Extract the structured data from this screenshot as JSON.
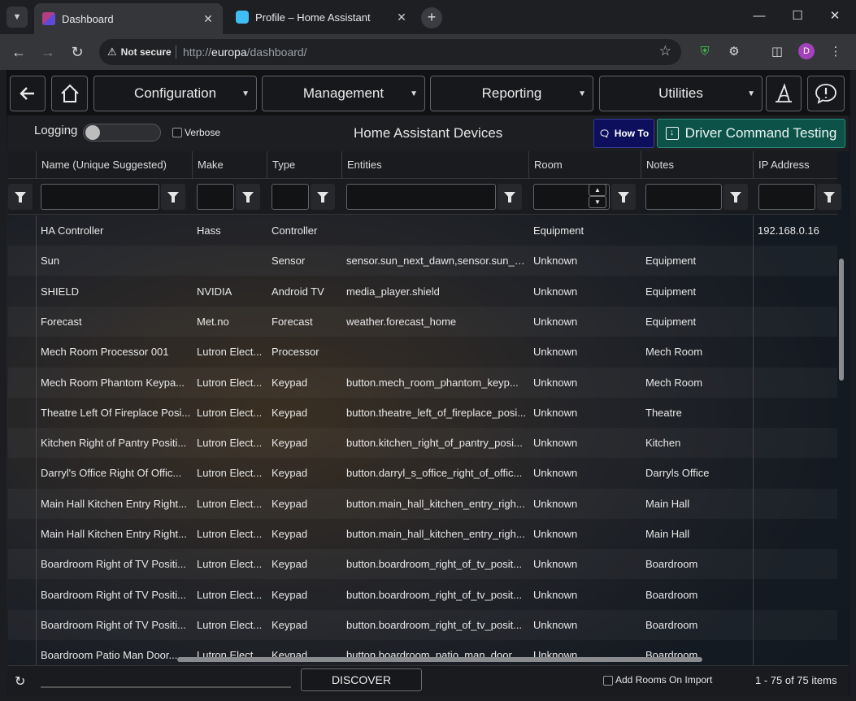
{
  "browser": {
    "tabs": [
      {
        "title": "Dashboard",
        "active": true
      },
      {
        "title": "Profile – Home Assistant",
        "active": false
      }
    ],
    "security_label": "Not secure",
    "url_prefix": "http://",
    "url_host": "europa",
    "url_path": "/dashboard/",
    "avatar_letter": "D"
  },
  "nav": {
    "menus": [
      "Configuration",
      "Management",
      "Reporting",
      "Utilities"
    ]
  },
  "header": {
    "logging_label": "Logging",
    "verbose_label": "Verbose",
    "title": "Home Assistant Devices",
    "howto_label": "How To",
    "driver_testing_label": "Driver Command Testing"
  },
  "grid": {
    "columns": [
      "Name (Unique Suggested)",
      "Make",
      "Type",
      "Entities",
      "Room",
      "Notes",
      "IP Address"
    ],
    "rows": [
      [
        "HA Controller",
        "Hass",
        "Controller",
        "",
        "Equipment",
        "",
        "192.168.0.16"
      ],
      [
        "Sun",
        "",
        "Sensor",
        "sensor.sun_next_dawn,sensor.sun_n...",
        "Unknown",
        "Equipment",
        ""
      ],
      [
        "SHIELD",
        "NVIDIA",
        "Android TV",
        "media_player.shield",
        "Unknown",
        "Equipment",
        ""
      ],
      [
        "Forecast",
        "Met.no",
        "Forecast",
        "weather.forecast_home",
        "Unknown",
        "Equipment",
        ""
      ],
      [
        "Mech Room Processor 001",
        "Lutron Elect...",
        "Processor",
        "",
        "Unknown",
        "Mech Room",
        ""
      ],
      [
        "Mech Room Phantom Keypa...",
        "Lutron Elect...",
        "Keypad",
        "button.mech_room_phantom_keyp...",
        "Unknown",
        "Mech Room",
        ""
      ],
      [
        "Theatre Left Of Fireplace Posi...",
        "Lutron Elect...",
        "Keypad",
        "button.theatre_left_of_fireplace_posi...",
        "Unknown",
        "Theatre",
        ""
      ],
      [
        "Kitchen Right of Pantry Positi...",
        "Lutron Elect...",
        "Keypad",
        "button.kitchen_right_of_pantry_posi...",
        "Unknown",
        "Kitchen",
        ""
      ],
      [
        "Darryl's Office Right Of Offic...",
        "Lutron Elect...",
        "Keypad",
        "button.darryl_s_office_right_of_offic...",
        "Unknown",
        "Darryls Office",
        ""
      ],
      [
        "Main Hall Kitchen Entry Right...",
        "Lutron Elect...",
        "Keypad",
        "button.main_hall_kitchen_entry_righ...",
        "Unknown",
        "Main Hall",
        ""
      ],
      [
        "Main Hall Kitchen Entry Right...",
        "Lutron Elect...",
        "Keypad",
        "button.main_hall_kitchen_entry_righ...",
        "Unknown",
        "Main Hall",
        ""
      ],
      [
        "Boardroom Right of TV Positi...",
        "Lutron Elect...",
        "Keypad",
        "button.boardroom_right_of_tv_posit...",
        "Unknown",
        "Boardroom",
        ""
      ],
      [
        "Boardroom Right of TV Positi...",
        "Lutron Elect...",
        "Keypad",
        "button.boardroom_right_of_tv_posit...",
        "Unknown",
        "Boardroom",
        ""
      ],
      [
        "Boardroom Right of TV Positi...",
        "Lutron Elect...",
        "Keypad",
        "button.boardroom_right_of_tv_posit...",
        "Unknown",
        "Boardroom",
        ""
      ],
      [
        "Boardroom Patio Man Door...",
        "Lutron Elect...",
        "Keypad",
        "button.boardroom_patio_man_door...",
        "Unknown",
        "Boardroom",
        ""
      ]
    ]
  },
  "footer": {
    "discover_label": "DISCOVER",
    "add_rooms_label": "Add Rooms On Import",
    "pager_info": "1 - 75 of 75 items"
  }
}
